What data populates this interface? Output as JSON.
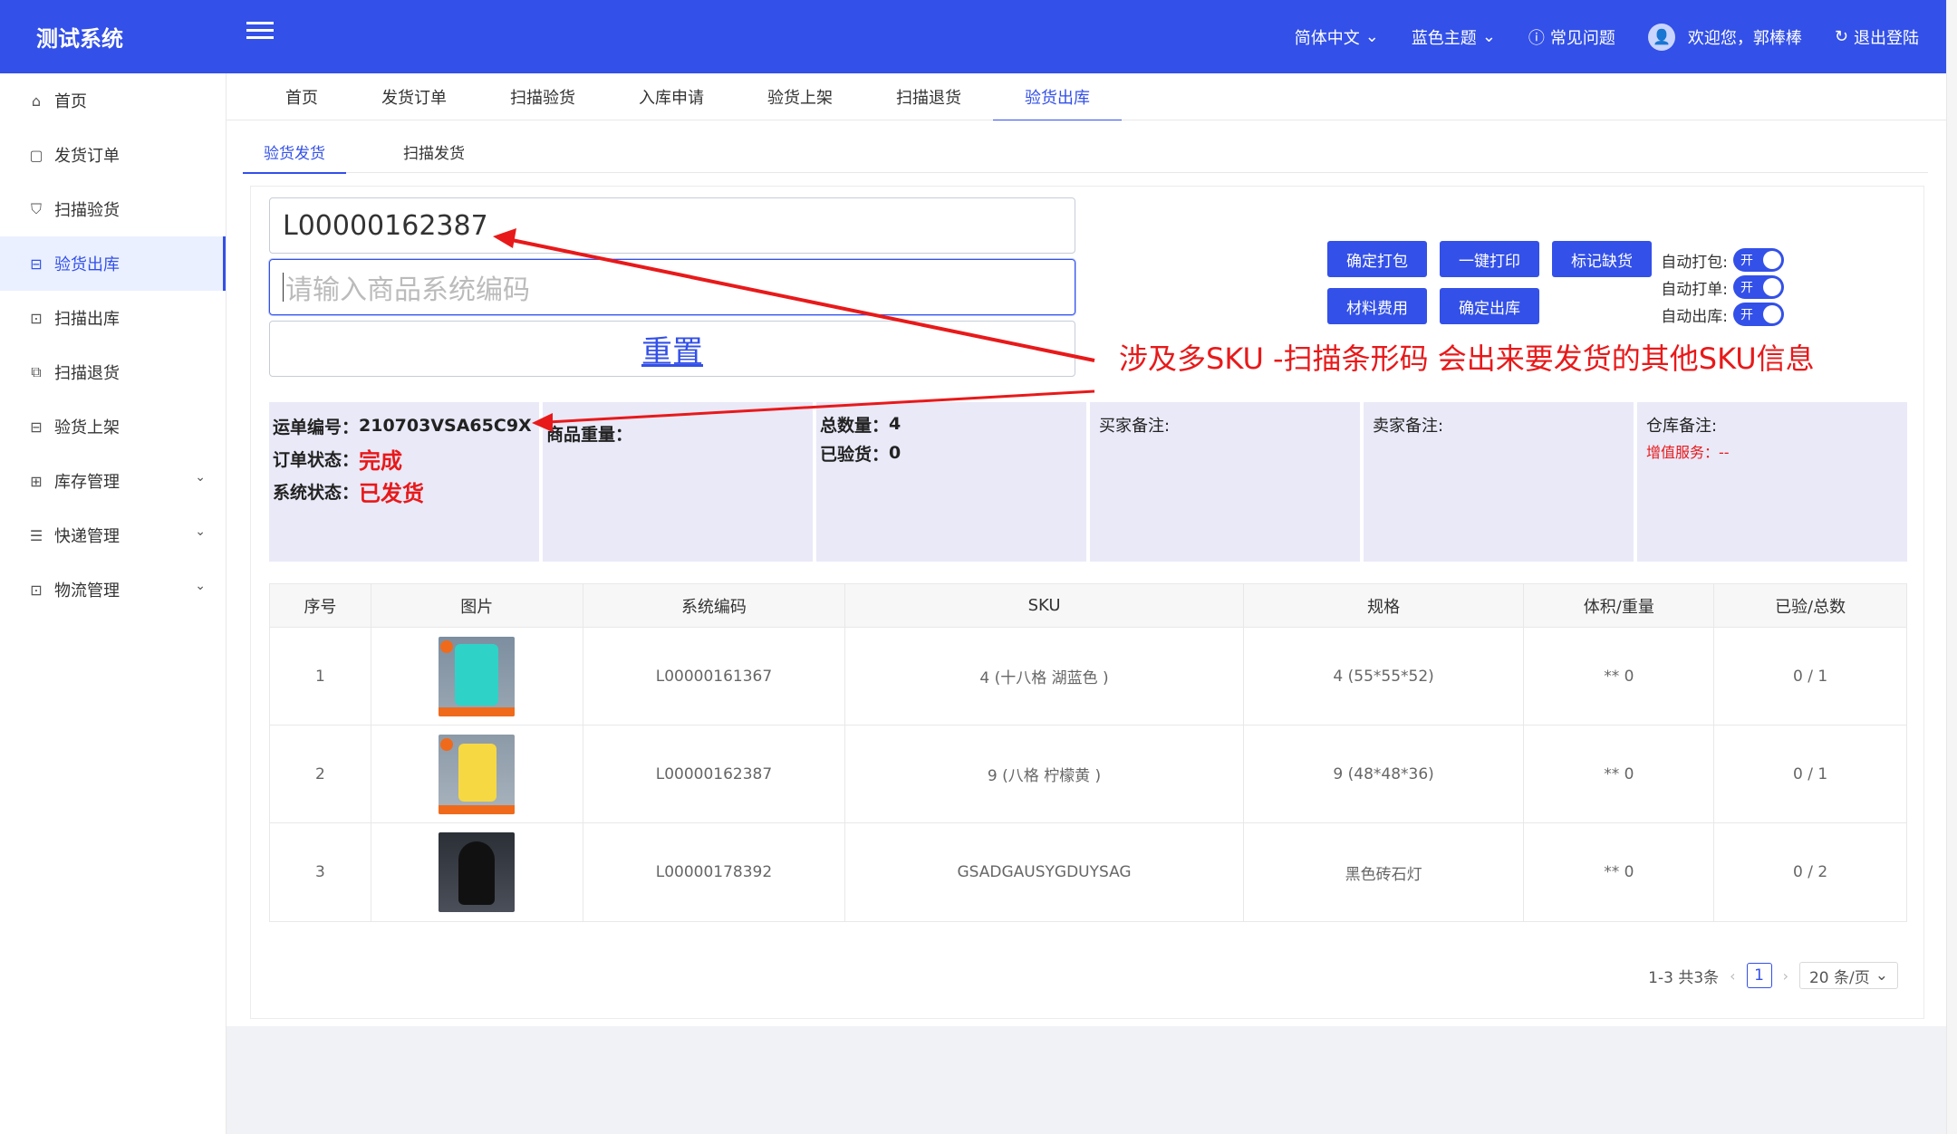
{
  "app": {
    "title": "测试系统"
  },
  "header": {
    "language": "简体中文",
    "theme": "蓝色主题",
    "faq": "常见问题",
    "welcome": "欢迎您，郭棒棒",
    "logout": "退出登陆"
  },
  "sidebar": {
    "items": [
      {
        "label": "首页",
        "icon": "home-icon"
      },
      {
        "label": "发货订单",
        "icon": "bag-icon"
      },
      {
        "label": "扫描验货",
        "icon": "shield-icon"
      },
      {
        "label": "验货出库",
        "icon": "scan-icon"
      },
      {
        "label": "扫描出库",
        "icon": "truck-icon"
      },
      {
        "label": "扫描退货",
        "icon": "return-icon"
      },
      {
        "label": "验货上架",
        "icon": "scan-icon"
      },
      {
        "label": "库存管理",
        "icon": "grid-icon"
      },
      {
        "label": "快递管理",
        "icon": "list-icon"
      },
      {
        "label": "物流管理",
        "icon": "truck-icon"
      }
    ]
  },
  "topnav": {
    "tabs": [
      "首页",
      "发货订单",
      "扫描验货",
      "入库申请",
      "验货上架",
      "扫描退货",
      "验货出库"
    ]
  },
  "subtabs": {
    "tabs": [
      "验货发货",
      "扫描发货"
    ]
  },
  "form": {
    "order_value": "L00000162387",
    "code_placeholder": "请输入商品系统编码",
    "reset_label": "重置"
  },
  "actions": {
    "confirm_pack": "确定打包",
    "one_click_print": "一键打印",
    "mark_short": "标记缺货",
    "material_fee": "材料费用",
    "confirm_out": "确定出库"
  },
  "toggles": [
    {
      "label": "自动打包:",
      "state": "开"
    },
    {
      "label": "自动打单:",
      "state": "开"
    },
    {
      "label": "自动出库:",
      "state": "开"
    }
  ],
  "annotation": "涉及多SKU  -扫描条形码 会出来要发货的其他SKU信息",
  "info": {
    "waybill_label": "运单编号：",
    "waybill_value": "210703VSA65C9X",
    "order_status_label": "订单状态：",
    "order_status_value": "完成",
    "system_status_label": "系统状态：",
    "system_status_value": "已发货",
    "weight_label": "商品重量：",
    "total_label": "总数量：",
    "total_value": "4",
    "checked_label": "已验货：",
    "checked_value": "0",
    "buyer_note": "买家备注:",
    "seller_note": "卖家备注:",
    "warehouse_note": "仓库备注:",
    "value_added": "增值服务：--"
  },
  "table": {
    "headers": [
      "序号",
      "图片",
      "系统编码",
      "SKU",
      "规格",
      "体积/重量",
      "已验/总数"
    ],
    "rows": [
      {
        "index": "1",
        "code": "L00000161367",
        "sku": "4  (十八格 湖蓝色 )",
        "spec": "4  (55*55*52)",
        "volume": "** 0",
        "checked": "0 / 1"
      },
      {
        "index": "2",
        "code": "L00000162387",
        "sku": "9  (八格 柠檬黄 )",
        "spec": "9  (48*48*36)",
        "volume": "** 0",
        "checked": "0 / 1"
      },
      {
        "index": "3",
        "code": "L00000178392",
        "sku": "GSADGAUSYGDUYSAG",
        "spec": "黑色砖石灯",
        "volume": "** 0",
        "checked": "0 / 2"
      }
    ]
  },
  "pager": {
    "summary": "1-3 共3条",
    "current": "1",
    "page_size": "20 条/页"
  },
  "colors": {
    "primary": "#3350e8",
    "annotation": "#e8191a",
    "info_bg": "#e9e9f8"
  }
}
